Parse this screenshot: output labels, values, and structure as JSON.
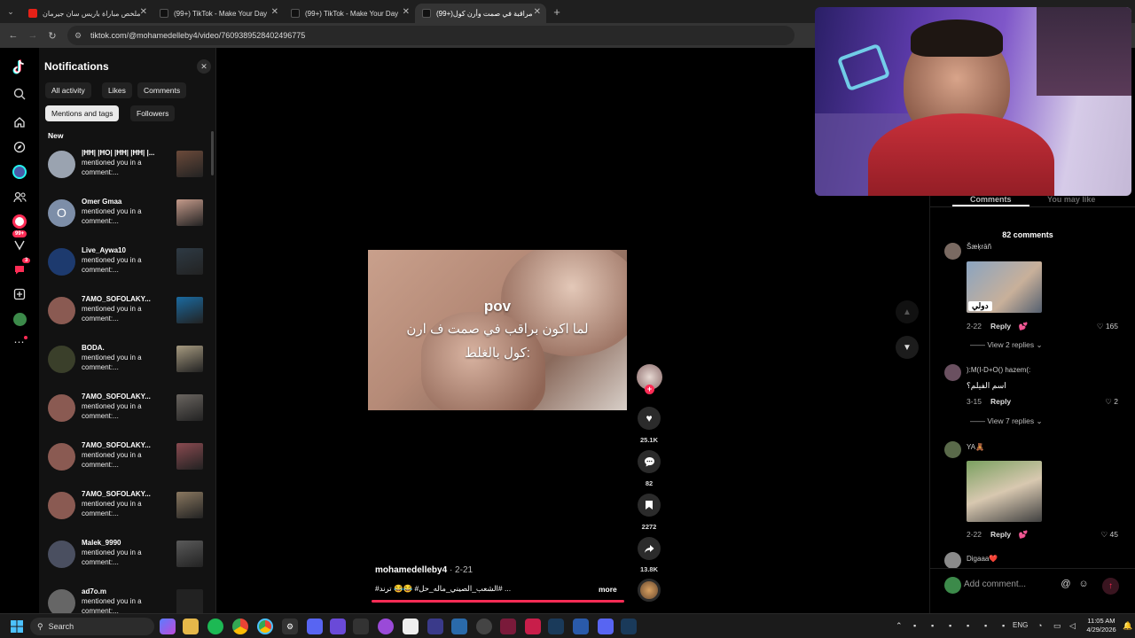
{
  "browser": {
    "tabs": [
      {
        "title": "ملخص مباراة باريس سان جيرمان",
        "favicon_color": "#e62117"
      },
      {
        "title": "(99+) TikTok - Make Your Day",
        "favicon_color": "#111111"
      },
      {
        "title": "(99+) TikTok - Make Your Day",
        "favicon_color": "#111111"
      },
      {
        "title": "(99+)مراقبة في صمت وأرن كول",
        "favicon_color": "#111111"
      }
    ],
    "url": "tiktok.com/@mohamedelleby4/video/7609389528402496775"
  },
  "rail": {
    "badge_count": "99+",
    "message_badge": "3"
  },
  "notifications": {
    "title": "Notifications",
    "filters": [
      "All activity",
      "Likes",
      "Comments",
      "Mentions and tags",
      "Followers"
    ],
    "selected_filter": "Mentions and tags",
    "section_label": "New",
    "items": [
      {
        "name": "|ĦĦ| |ĦO| |ĦĦ| |ĦĦ| |...",
        "text": "mentioned you in a comment:...",
        "avatar_color": "#9aa3b0",
        "thumb_color": "#6b4a3a"
      },
      {
        "name": "Omer Gmaa",
        "text": "mentioned you in a comment:...",
        "avatar_color": "#7d8ea8",
        "avatar_letter": "O",
        "thumb_color": "#c49a8a"
      },
      {
        "name": "Live_Aywa10",
        "text": "mentioned you in a comment:...",
        "avatar_color": "#1d3a6e",
        "thumb_color": "#2e3a44"
      },
      {
        "name": "7AMO_SOFOLAKY...",
        "text": "mentioned you in a comment:...",
        "avatar_color": "#8a5a52",
        "thumb_color": "#1a6aa0"
      },
      {
        "name": "BODA.",
        "text": "mentioned you in a comment:...",
        "avatar_color": "#3a3f2a",
        "thumb_color": "#a69a80"
      },
      {
        "name": "7AMO_SOFOLAKY...",
        "text": "mentioned you in a comment:...",
        "avatar_color": "#8a5a52",
        "thumb_color": "#6a6560"
      },
      {
        "name": "7AMO_SOFOLAKY...",
        "text": "mentioned you in a comment:...",
        "avatar_color": "#8a5a52",
        "thumb_color": "#8a4a50"
      },
      {
        "name": "7AMO_SOFOLAKY...",
        "text": "mentioned you in a comment:...",
        "avatar_color": "#8a5a52",
        "thumb_color": "#8a7860"
      },
      {
        "name": "Malek_9990",
        "text": "mentioned you in a comment:...",
        "avatar_color": "#4a4f60",
        "thumb_color": "#5a5a5a"
      },
      {
        "name": "ad7o.m",
        "text": "mentioned you in a comment:...",
        "avatar_color": "#666666",
        "thumb_color": "#222222"
      }
    ]
  },
  "video": {
    "overlay_title": "pov",
    "overlay_line1": "لما اكون براقب في صمت ف ارن",
    "overlay_line2": "كول بالغلط:",
    "author": "mohamedelleby4",
    "date": "· 2-21",
    "tags": "#الشعب_الصيني_ماله_حل# 😂😂 ترند# ...",
    "more_label": "more",
    "likes": "25.1K",
    "comments": "82",
    "saves": "2272",
    "shares": "13.8K"
  },
  "comments_panel": {
    "tabs": [
      "Comments",
      "You may like"
    ],
    "count_label": "82 comments",
    "comments": [
      {
        "user": "Šæķrāñ",
        "text": "",
        "meta": "2-22",
        "reply_label": "Reply",
        "likes": "165",
        "replies": "View 2 replies",
        "image_caption": "دولي"
      },
      {
        "user": "):M(I-D+O() hazem(:",
        "text": "اسم الفيلم؟",
        "meta": "3-15",
        "reply_label": "Reply",
        "likes": "2",
        "replies": "View 7 replies"
      },
      {
        "user": "YA🧸",
        "text": "",
        "meta": "2-22",
        "reply_label": "Reply",
        "likes": "45"
      },
      {
        "user": "Digaaa❤️",
        "text": ""
      }
    ],
    "input_placeholder": "Add comment..."
  },
  "taskbar": {
    "search_label": "Search",
    "lang": "ENG",
    "time": "11:05 AM",
    "date": "4/29/2026"
  }
}
